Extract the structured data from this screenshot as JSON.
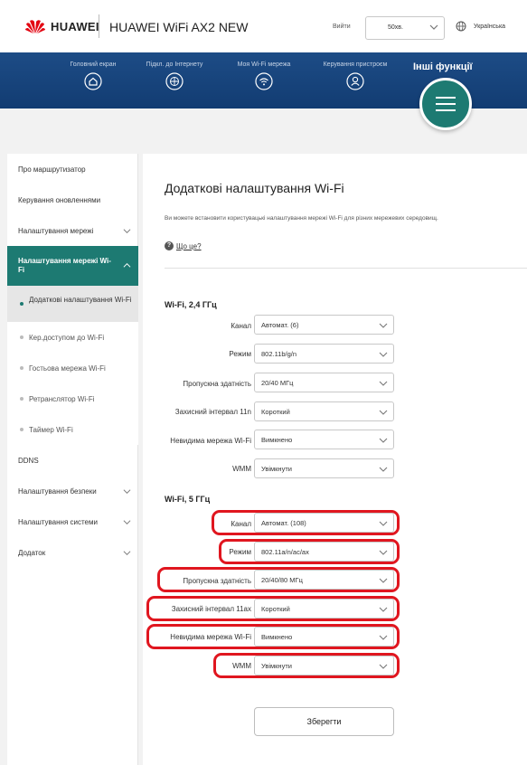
{
  "header": {
    "brand": "HUAWEI",
    "product": "HUAWEI WiFi AX2 NEW",
    "login": "Вийти",
    "timezone_value": "50хв.",
    "language": "Українська"
  },
  "nav": {
    "items": [
      {
        "label": "Головний екран",
        "icon": "home-icon"
      },
      {
        "label": "Підкл. до Інтернету",
        "icon": "globe-icon"
      },
      {
        "label": "Моя Wi-Fi мережа",
        "icon": "wifi-icon"
      },
      {
        "label": "Керування пристроєм",
        "icon": "user-icon"
      }
    ],
    "more_label": "Інші функції",
    "menu_icon": "hamburger-icon"
  },
  "sidebar": {
    "items": [
      {
        "label": "Про маршрутизатор"
      },
      {
        "label": "Керування оновленнями"
      },
      {
        "label": "Налаштування мережі"
      },
      {
        "label": "Налаштування мережі Wi-Fi"
      },
      {
        "label": "Додаткові налаштування Wi-Fi"
      },
      {
        "label": "Кер.доступом до Wi-Fi"
      },
      {
        "label": "Гостьова мережа Wi-Fi"
      },
      {
        "label": "Ретранслятор Wi-Fi"
      },
      {
        "label": "Таймер Wi-Fi"
      },
      {
        "label": "DDNS"
      },
      {
        "label": "Налаштування безпеки"
      },
      {
        "label": "Налаштування системи"
      },
      {
        "label": "Додаток"
      }
    ]
  },
  "main": {
    "title": "Додаткові налаштування Wi-Fi",
    "description": "Ви можете встановити користувацькі налаштування мережі Wi-Fi для різних мережевих середовищ.",
    "help_link": "Що це?",
    "band24": {
      "title": "Wi-Fi, 2,4 ГГц",
      "rows": [
        {
          "label": "Канал",
          "value": "Автомат. (6)"
        },
        {
          "label": "Режим",
          "value": "802.11b/g/n"
        },
        {
          "label": "Пропускна здатність",
          "value": "20/40 МГц"
        },
        {
          "label": "Захисний інтервал 11n",
          "value": "Короткий"
        },
        {
          "label": "Невидима мережа Wi-Fi",
          "value": "Вимкнено"
        },
        {
          "label": "WMM",
          "value": "Увімкнути"
        }
      ]
    },
    "band5": {
      "title": "Wi-Fi, 5 ГГц",
      "rows": [
        {
          "label": "Канал",
          "value": "Автомат. (108)"
        },
        {
          "label": "Режим",
          "value": "802.11a/n/ac/ax"
        },
        {
          "label": "Пропускна здатність",
          "value": "20/40/80 МГц"
        },
        {
          "label": "Захисний інтервал 11ax",
          "value": "Короткий"
        },
        {
          "label": "Невидима мережа Wi-Fi",
          "value": "Вимкнено"
        },
        {
          "label": "WMM",
          "value": "Увімкнути"
        }
      ]
    },
    "save_label": "Зберегти"
  },
  "colors": {
    "nav_bg": "#1d4c86",
    "accent": "#1d7a72",
    "annotation": "#e0161f"
  }
}
